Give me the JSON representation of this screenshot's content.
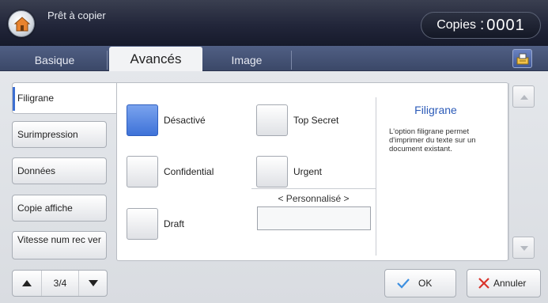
{
  "header": {
    "title": "Prêt à copier",
    "copies_label": "Copies",
    "copies_separator": ":",
    "copies_value": "0001"
  },
  "tabs": [
    {
      "label": "Basique",
      "active": false
    },
    {
      "label": "Avancés",
      "active": true
    },
    {
      "label": "Image",
      "active": false
    }
  ],
  "sidebar": {
    "items": [
      {
        "label": "Filigrane",
        "active": true
      },
      {
        "label": "Surimpression",
        "active": false
      },
      {
        "label": "Données",
        "active": false
      },
      {
        "label": "Copie affiche",
        "active": false
      },
      {
        "label": "Vitesse num rec ver",
        "active": false
      }
    ]
  },
  "options": {
    "desactive": {
      "label": "Désactivé",
      "selected": true
    },
    "top_secret": {
      "label": "Top Secret",
      "selected": false
    },
    "confidential": {
      "label": "Confidential",
      "selected": false
    },
    "urgent": {
      "label": "Urgent",
      "selected": false
    },
    "draft": {
      "label": "Draft",
      "selected": false
    },
    "personnalise_label": "< Personnalisé >",
    "personnalise_value": ""
  },
  "description": {
    "title": "Filigrane",
    "text": "L'option filigrane permet d'imprimer du texte sur un document existant."
  },
  "pager": {
    "text": "3/4"
  },
  "actions": {
    "ok": "OK",
    "cancel": "Annuler"
  },
  "colors": {
    "accent": "#3e72d8",
    "cancel_x": "#d9342b",
    "ok_check": "#3d8fe0"
  }
}
